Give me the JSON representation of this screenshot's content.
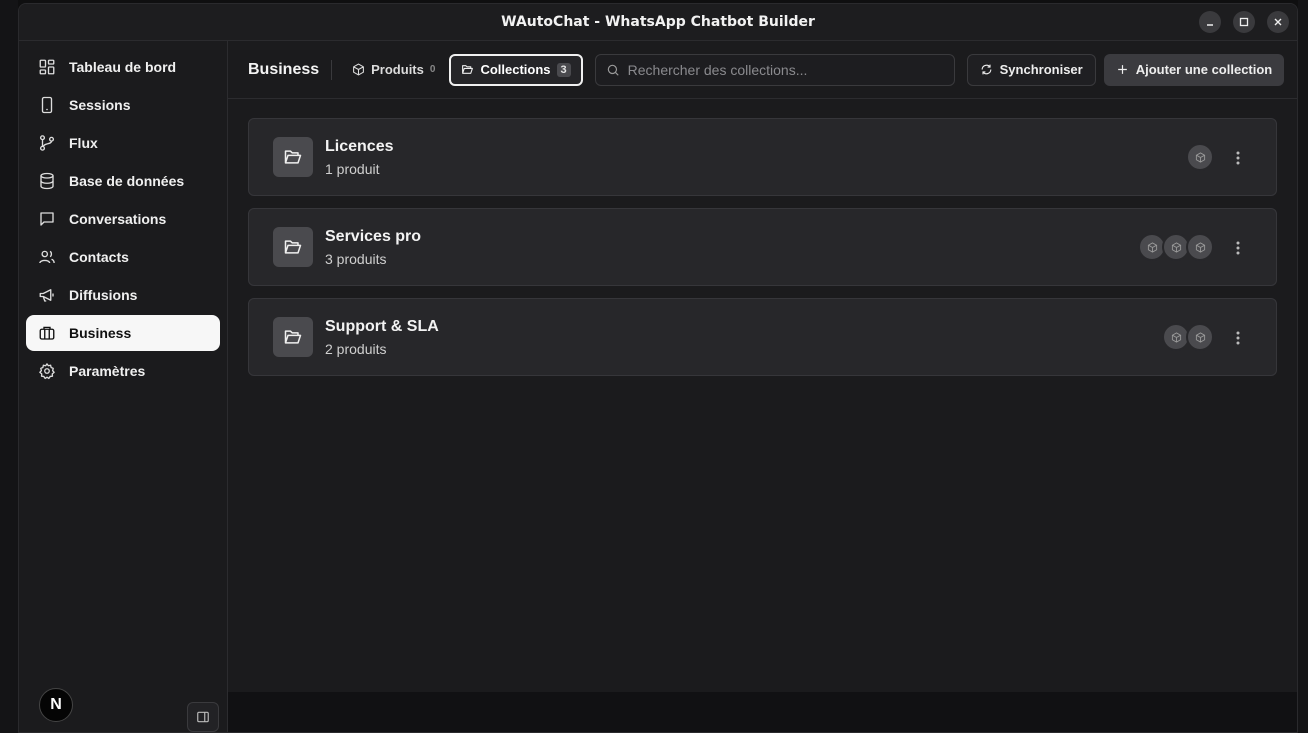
{
  "window": {
    "title": "WAutoChat - WhatsApp Chatbot Builder"
  },
  "sidebar": {
    "items": [
      {
        "label": "Tableau de bord",
        "icon": "dashboard-icon"
      },
      {
        "label": "Sessions",
        "icon": "phone-icon"
      },
      {
        "label": "Flux",
        "icon": "git-branch-icon"
      },
      {
        "label": "Base de données",
        "icon": "database-icon"
      },
      {
        "label": "Conversations",
        "icon": "message-square-icon"
      },
      {
        "label": "Contacts",
        "icon": "users-icon"
      },
      {
        "label": "Diffusions",
        "icon": "megaphone-icon"
      },
      {
        "label": "Business",
        "icon": "briefcase-icon",
        "active": true
      },
      {
        "label": "Paramètres",
        "icon": "settings-icon"
      }
    ],
    "avatar": "N"
  },
  "header": {
    "title": "Business",
    "tabs": [
      {
        "label": "Produits",
        "count": "0"
      },
      {
        "label": "Collections",
        "count": "3",
        "active": true
      }
    ],
    "search_placeholder": "Rechercher des collections...",
    "sync_label": "Synchroniser",
    "add_label": "Ajouter une collection"
  },
  "collections": [
    {
      "name": "Licences",
      "count": "1 produit",
      "thumbs": 1
    },
    {
      "name": "Services pro",
      "count": "3 produits",
      "thumbs": 3
    },
    {
      "name": "Support & SLA",
      "count": "2 produits",
      "thumbs": 2
    }
  ],
  "colors": {
    "accent_active": "#f7f7f7",
    "card_bg": "#27272a",
    "window_bg": "#1b1b1d"
  }
}
